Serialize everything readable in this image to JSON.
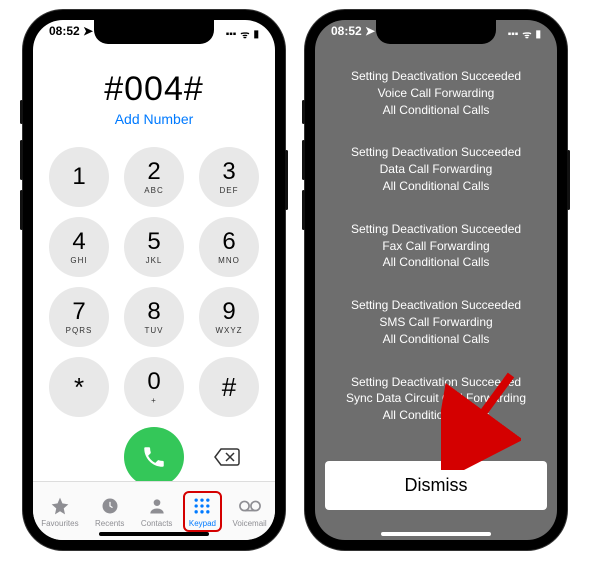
{
  "status": {
    "time": "08:52",
    "loc_arrow": "➤",
    "signal": "▪▪▪",
    "wifi": "ᯤ",
    "battery": "▮"
  },
  "dialer": {
    "number": "#004#",
    "add_label": "Add Number",
    "keys": [
      {
        "digit": "1",
        "letters": ""
      },
      {
        "digit": "2",
        "letters": "ABC"
      },
      {
        "digit": "3",
        "letters": "DEF"
      },
      {
        "digit": "4",
        "letters": "GHI"
      },
      {
        "digit": "5",
        "letters": "JKL"
      },
      {
        "digit": "6",
        "letters": "MNO"
      },
      {
        "digit": "7",
        "letters": "PQRS"
      },
      {
        "digit": "8",
        "letters": "TUV"
      },
      {
        "digit": "9",
        "letters": "WXYZ"
      },
      {
        "digit": "*",
        "letters": ""
      },
      {
        "digit": "0",
        "letters": "+"
      },
      {
        "digit": "#",
        "letters": ""
      }
    ]
  },
  "tabs": [
    {
      "label": "Favourites"
    },
    {
      "label": "Recents"
    },
    {
      "label": "Contacts"
    },
    {
      "label": "Keypad"
    },
    {
      "label": "Voicemail"
    }
  ],
  "messages": [
    [
      "Setting Deactivation Succeeded",
      "Voice Call Forwarding",
      "All Conditional Calls"
    ],
    [
      "Setting Deactivation Succeeded",
      "Data Call Forwarding",
      "All Conditional Calls"
    ],
    [
      "Setting Deactivation Succeeded",
      "Fax Call Forwarding",
      "All Conditional Calls"
    ],
    [
      "Setting Deactivation Succeeded",
      "SMS Call Forwarding",
      "All Conditional Calls"
    ],
    [
      "Setting Deactivation Succeeded",
      "Sync Data Circuit Call Forwarding",
      "All Conditional Calls"
    ]
  ],
  "dismiss_label": "Dismiss",
  "colors": {
    "accent": "#007aff",
    "call_green": "#34c759",
    "arrow": "#d40000"
  }
}
